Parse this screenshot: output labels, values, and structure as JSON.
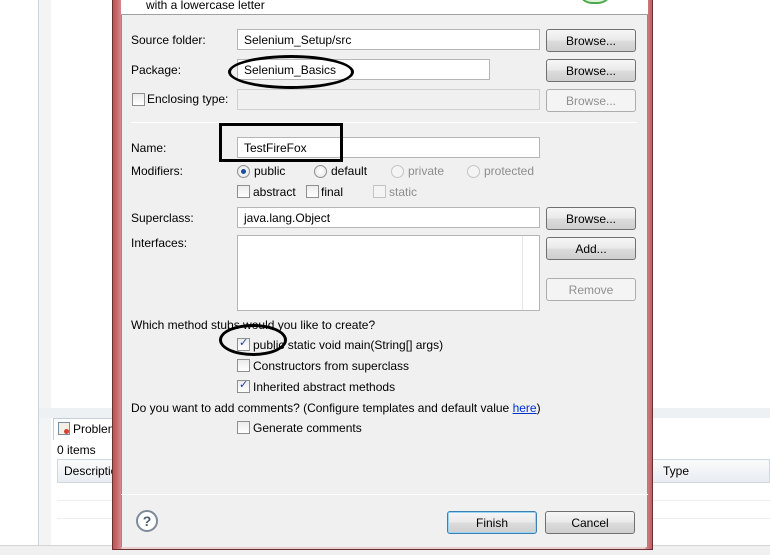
{
  "background": {
    "problems_tab_label": "Problen",
    "items_count": "0 items",
    "columns": [
      "Descriptio",
      "Type"
    ],
    "resize_grip": "'''"
  },
  "dialog": {
    "header_message": "with a lowercase letter",
    "source_folder": {
      "label": "Source folder:",
      "value": "Selenium_Setup/src",
      "browse": "Browse..."
    },
    "package": {
      "label": "Package:",
      "value": "Selenium_Basics",
      "browse": "Browse..."
    },
    "enclosing_type": {
      "label": "Enclosing type:",
      "value": "",
      "browse": "Browse...",
      "checked": false
    },
    "name": {
      "label": "Name:",
      "value": "TestFireFox"
    },
    "modifiers": {
      "label": "Modifiers:",
      "options": [
        "public",
        "default",
        "private",
        "protected"
      ],
      "selected": "public",
      "abstract": "abstract",
      "final": "final",
      "static": "static"
    },
    "superclass": {
      "label": "Superclass:",
      "value": "java.lang.Object",
      "browse": "Browse..."
    },
    "interfaces": {
      "label": "Interfaces:",
      "add": "Add...",
      "remove": "Remove"
    },
    "method_stubs": {
      "question": "Which method stubs would you like to create?",
      "main": "public static void main(String[] args)",
      "constructors": "Constructors from superclass",
      "inherited": "Inherited abstract methods"
    },
    "comments": {
      "question_prefix": "Do you want to add comments? (Configure templates and default value ",
      "link": "here",
      "question_suffix": ")",
      "generate": "Generate comments"
    },
    "help_icon": "?",
    "finish": "Finish",
    "cancel": "Cancel"
  }
}
